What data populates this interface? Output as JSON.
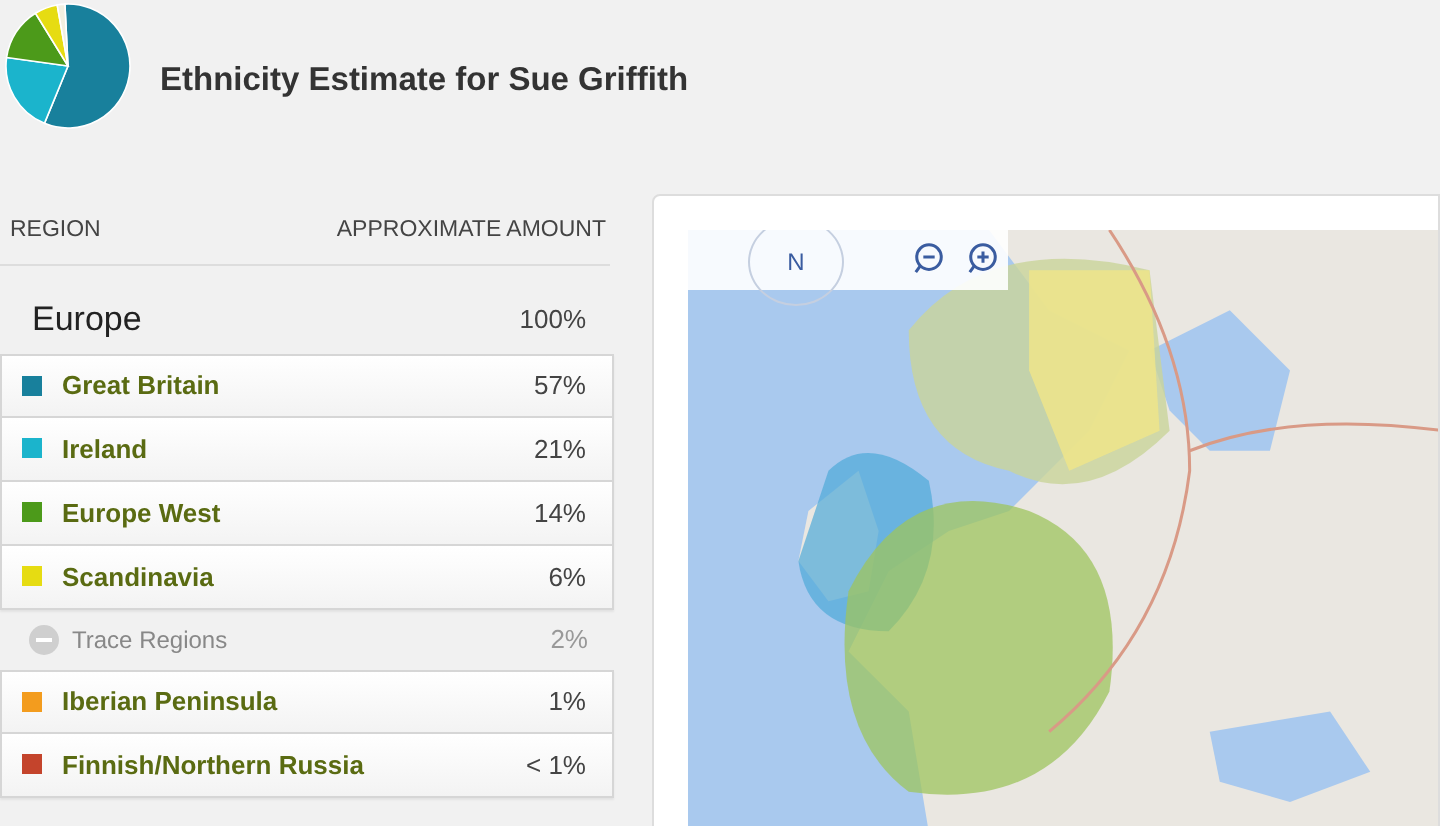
{
  "title": "Ethnicity Estimate for Sue Griffith",
  "table": {
    "columns": [
      "REGION",
      "APPROXIMATE AMOUNT"
    ],
    "group": {
      "name": "Europe",
      "amount": "100%"
    },
    "rows": [
      {
        "kind": "region",
        "name": "Great Britain",
        "amount": "57%",
        "color": "#18809c"
      },
      {
        "kind": "region",
        "name": "Ireland",
        "amount": "21%",
        "color": "#1bb4cc"
      },
      {
        "kind": "region",
        "name": "Europe West",
        "amount": "14%",
        "color": "#4c9a1a"
      },
      {
        "kind": "region",
        "name": "Scandinavia",
        "amount": "6%",
        "color": "#e6dc12"
      },
      {
        "kind": "trace",
        "name": "Trace Regions",
        "amount": "2%"
      },
      {
        "kind": "region",
        "name": "Iberian Peninsula",
        "amount": "1%",
        "color": "#f39c1e"
      },
      {
        "kind": "region",
        "name": "Finnish/Northern Russia",
        "amount": "< 1%",
        "color": "#c4442c"
      }
    ]
  },
  "map": {
    "compass_label": "N"
  }
}
